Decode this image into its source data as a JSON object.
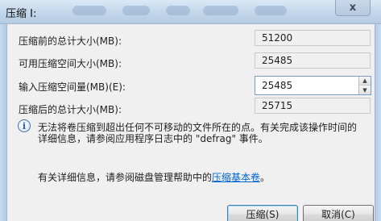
{
  "window": {
    "title": "压缩 I:",
    "close_glyph": "x"
  },
  "form": {
    "total_before": {
      "label": "压缩前的总计大小(MB):",
      "value": "51200"
    },
    "available": {
      "label": "可用压缩空间大小(MB):",
      "value": "25485"
    },
    "input_amount": {
      "label": "输入压缩空间量(MB)(E):",
      "value": "25485"
    },
    "total_after": {
      "label": "压缩后的总计大小(MB):",
      "value": "25715"
    }
  },
  "info": {
    "icon_glyph": "i",
    "line1": "无法将卷压缩到超出任何不可移动的文件所在的点。有关完成该操作时间的",
    "line2": "详细信息，请参阅应用程序日志中的 \"defrag\" 事件。"
  },
  "help": {
    "prefix": "有关详细信息，请参阅磁盘管理帮助中的",
    "link": "压缩基本卷",
    "suffix": "。"
  },
  "buttons": {
    "shrink": "压缩(S)",
    "cancel": "取消(C)"
  }
}
